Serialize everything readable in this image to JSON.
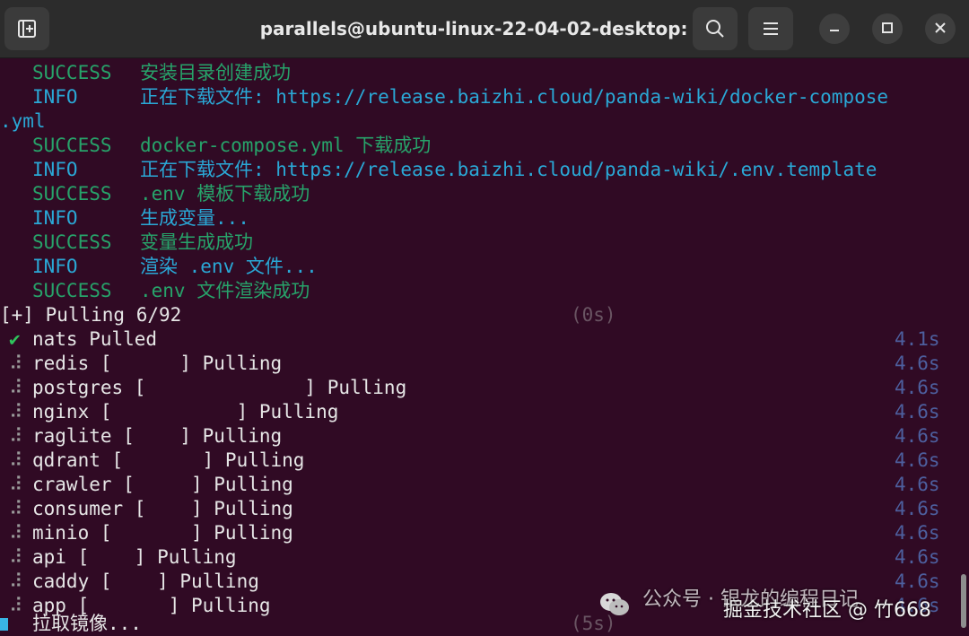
{
  "window": {
    "title": "parallels@ubuntu-linux-22-04-02-desktop: ~"
  },
  "icons": {
    "new_tab": "new-tab-icon",
    "search": "search-icon",
    "menu": "hamburger-menu-icon",
    "minimize": "minimize-icon",
    "maximize": "maximize-icon",
    "close": "close-icon"
  },
  "colors": {
    "background": "#300a24",
    "success": "#27a36a",
    "info": "#2aa8d6"
  },
  "log": [
    {
      "level": "SUCCESS",
      "message": "安装目录创建成功"
    },
    {
      "level": "INFO",
      "message": "正在下载文件: https://release.baizhi.cloud/panda-wiki/docker-compose"
    },
    {
      "level": "",
      "message": ".yml"
    },
    {
      "level": "SUCCESS",
      "message": "docker-compose.yml 下载成功"
    },
    {
      "level": "INFO",
      "message": "正在下载文件: https://release.baizhi.cloud/panda-wiki/.env.template"
    },
    {
      "level": "SUCCESS",
      "message": ".env 模板下载成功"
    },
    {
      "level": "INFO",
      "message": "生成变量..."
    },
    {
      "level": "SUCCESS",
      "message": "变量生成成功"
    },
    {
      "level": "INFO",
      "message": "渲染 .env 文件..."
    },
    {
      "level": "SUCCESS",
      "message": ".env 文件渲染成功"
    }
  ],
  "pull": {
    "header": "[+] Pulling 6/92",
    "header_time": "(0s)",
    "items": [
      {
        "status": "✔",
        "text": "nats Pulled",
        "time": "4.1s"
      },
      {
        "status": "⠼",
        "text": "redis [      ] Pulling",
        "time": "4.6s"
      },
      {
        "status": "⠼",
        "text": "postgres [              ] Pulling",
        "time": "4.6s"
      },
      {
        "status": "⠼",
        "text": "nginx [           ] Pulling",
        "time": "4.6s"
      },
      {
        "status": "⠼",
        "text": "raglite [    ] Pulling",
        "time": "4.6s"
      },
      {
        "status": "⠼",
        "text": "qdrant [       ] Pulling",
        "time": "4.6s"
      },
      {
        "status": "⠼",
        "text": "crawler [     ] Pulling",
        "time": "4.6s"
      },
      {
        "status": "⠼",
        "text": "consumer [    ] Pulling",
        "time": "4.6s"
      },
      {
        "status": "⠼",
        "text": "minio [       ] Pulling",
        "time": "4.6s"
      },
      {
        "status": "⠼",
        "text": "api [    ] Pulling",
        "time": "4.6s"
      },
      {
        "status": "⠼",
        "text": "caddy [    ] Pulling",
        "time": "4.6s"
      },
      {
        "status": "⠼",
        "text": "app [       ] Pulling",
        "time": "4.6s"
      }
    ],
    "footer": "拉取镜像...",
    "footer_time": "(5s)"
  },
  "watermark": {
    "line1": "公众号 · 银龙的编程日记",
    "line2": "掘金技术社区 @ 竹668"
  }
}
